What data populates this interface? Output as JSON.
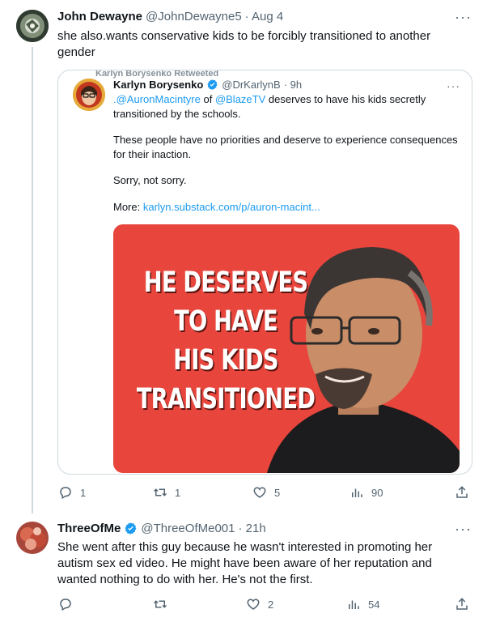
{
  "tweet1": {
    "name": "John Dewayne",
    "handle": "@JohnDewayne5",
    "time": "· Aug 4",
    "text": "she also.wants conservative kids to be forcibly transitioned to another gender",
    "more": "···",
    "quote": {
      "header_cut": "Karlyn Borysenko Retweeted",
      "name": "Karlyn Borysenko",
      "handle": "@DrKarlynB",
      "time": "· 9h",
      "more": "···",
      "mention1": ".@AuronMacintyre",
      "mid1": " of ",
      "mention2": "@BlazeTV",
      "line1_rest": " deserves to have his kids secretly transitioned by the schools.",
      "para2": "These people have no priorities and deserve to experience consequences for their inaction.",
      "para3": "Sorry, not sorry.",
      "more_label": "More: ",
      "more_link": "karlyn.substack.com/p/auron-macint...",
      "image_headline": [
        "HE DESERVES",
        "TO HAVE",
        "HIS KIDS",
        "TRANSITIONED"
      ]
    },
    "stats": {
      "replies": "1",
      "retweets": "1",
      "likes": "5",
      "views": "90"
    }
  },
  "tweet2": {
    "name": "ThreeOfMe",
    "handle": "@ThreeOfMe001",
    "time": "· 21h",
    "more": "···",
    "text": "She went after this guy because he wasn't interested in promoting her autism sex ed video. He might have been aware of her reputation and wanted nothing to do with her. He's not the first.",
    "stats": {
      "replies": "",
      "retweets": "",
      "likes": "2",
      "views": "54"
    }
  },
  "colors": {
    "link": "#1d9bf0",
    "verified": "#1d9bf0",
    "image_bg": "#e8453c",
    "muted": "#536471"
  },
  "icons": [
    "reply-icon",
    "retweet-icon",
    "like-icon",
    "views-icon",
    "share-icon",
    "verified-badge-icon",
    "more-icon"
  ]
}
